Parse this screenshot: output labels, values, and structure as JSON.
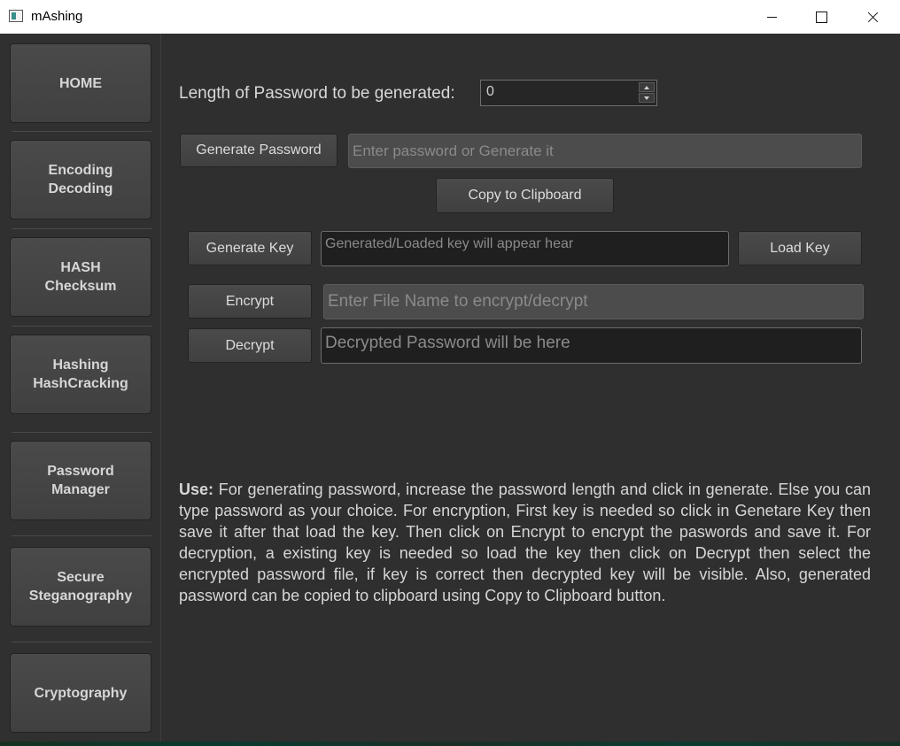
{
  "window": {
    "title": "mAshing"
  },
  "sidebar": {
    "items": [
      {
        "label": "HOME"
      },
      {
        "label": "Encoding\nDecoding"
      },
      {
        "label": "HASH\nChecksum"
      },
      {
        "label": "Hashing\nHashCracking"
      },
      {
        "label": "Password\nManager"
      },
      {
        "label": "Secure\nSteganography"
      },
      {
        "label": "Cryptography"
      }
    ]
  },
  "main": {
    "length_label": "Length of Password to be generated:",
    "length_value": "0",
    "generate_password_label": "Generate Password",
    "password_placeholder": "Enter password or Generate it",
    "copy_label": "Copy to Clipboard",
    "generate_key_label": "Generate Key",
    "key_placeholder": "Generated/Loaded key will appear hear",
    "load_key_label": "Load Key",
    "encrypt_label": "Encrypt",
    "file_placeholder": "Enter File Name to encrypt/decrypt",
    "decrypt_label": "Decrypt",
    "decrypted_placeholder": "Decrypted Password will be here",
    "help_bold": "Use:",
    "help_text": " For generating password, increase the password length and click in generate. Else you can type password as your choice. For encryption, First key is needed so click in Genetare Key then save it after that load the key. Then click on Encrypt to encrypt the paswords and save it. For decryption, a existing key is needed so load the key then click on Decrypt then select the encrypted password file, if key is correct then decrypted key will be visible. Also, generated password can be copied to clipboard using Copy to Clipboard button."
  }
}
